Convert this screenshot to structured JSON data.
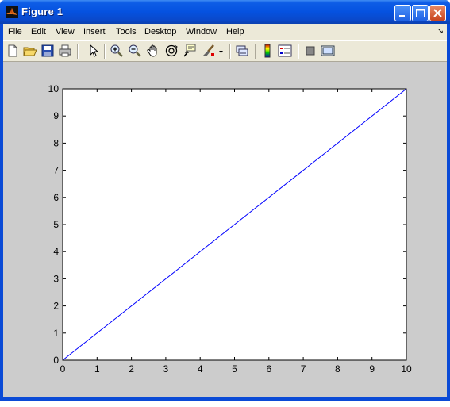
{
  "window": {
    "title": "Figure 1"
  },
  "menu": {
    "items": [
      "File",
      "Edit",
      "View",
      "Insert",
      "Tools",
      "Desktop",
      "Window",
      "Help"
    ],
    "overflow_glyph": "↘"
  },
  "toolbar": {
    "icons": [
      "new-figure-icon",
      "open-file-icon",
      "save-icon",
      "print-icon",
      "pointer-icon",
      "zoom-in-icon",
      "zoom-out-icon",
      "pan-icon",
      "rotate-3d-icon",
      "data-cursor-icon",
      "brush-icon",
      "brush-dropdown-icon",
      "link-plot-icon",
      "colorbar-icon",
      "legend-icon",
      "hide-plot-tools-icon",
      "show-plot-tools-icon"
    ]
  },
  "chart_data": {
    "type": "line",
    "x": [
      0,
      10
    ],
    "series": [
      {
        "values": [
          0,
          10
        ],
        "color": "#0000ff"
      }
    ],
    "xlim": [
      0,
      10
    ],
    "ylim": [
      0,
      10
    ],
    "xticks": [
      "0",
      "1",
      "2",
      "3",
      "4",
      "5",
      "6",
      "7",
      "8",
      "9",
      "10"
    ],
    "yticks": [
      "0",
      "1",
      "2",
      "3",
      "4",
      "5",
      "6",
      "7",
      "8",
      "9",
      "10"
    ],
    "title": "",
    "xlabel": "",
    "ylabel": "",
    "grid": false
  }
}
